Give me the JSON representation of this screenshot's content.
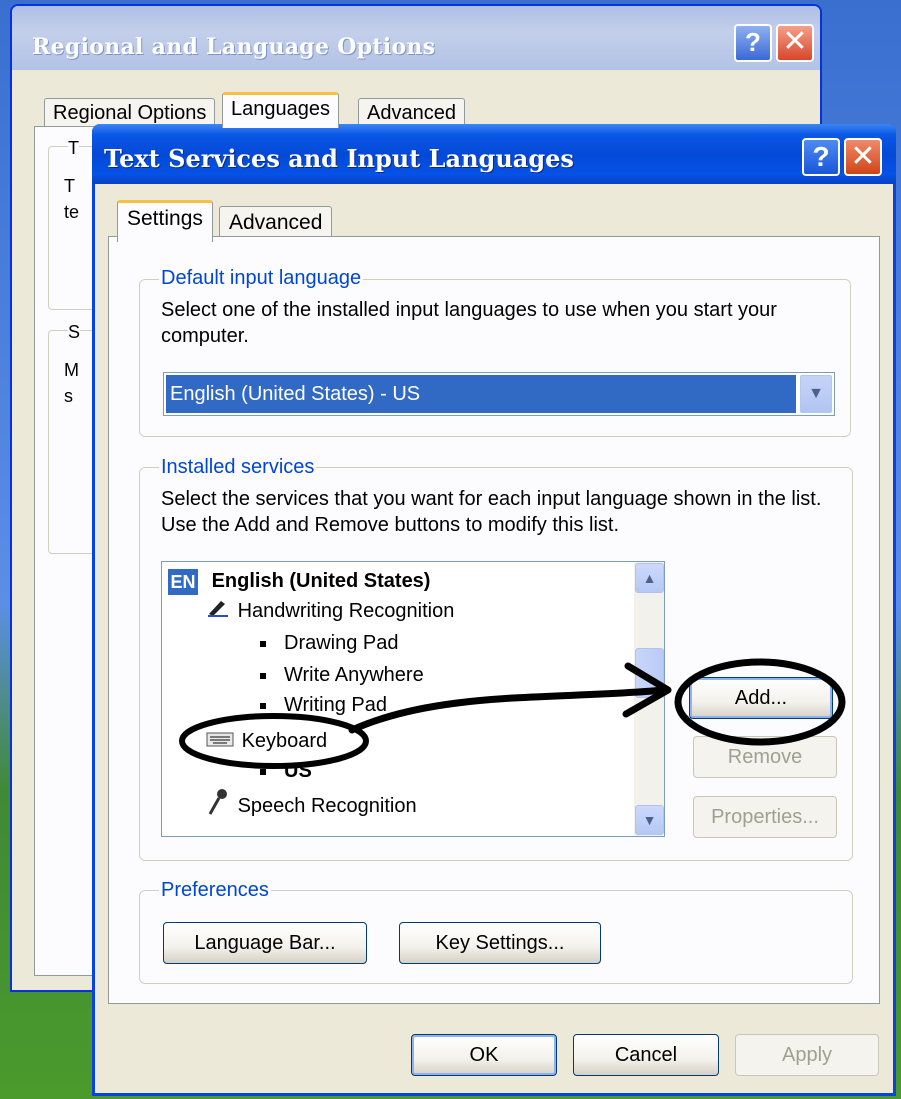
{
  "back_window": {
    "title": "Regional and Language Options",
    "tabs": [
      "Regional Options",
      "Languages",
      "Advanced"
    ],
    "fragments": [
      "T",
      "T",
      "te",
      "S",
      "M",
      "s"
    ]
  },
  "dialog": {
    "title": "Text Services and Input Languages",
    "tabs": [
      {
        "label": "Settings",
        "active": true
      },
      {
        "label": "Advanced",
        "active": false
      }
    ],
    "default_input": {
      "group_label": "Default input language",
      "description": "Select one of the installed input languages to use when you start your computer.",
      "combo_value": "English (United States) - US"
    },
    "installed_services": {
      "group_label": "Installed services",
      "description": "Select the services that you want for each input language shown in the list. Use the Add and Remove buttons to modify this list.",
      "language_badge": "EN",
      "language": "English (United States)",
      "handwriting": "Handwriting Recognition",
      "handwriting_items": [
        "Drawing Pad",
        "Write Anywhere",
        "Writing Pad"
      ],
      "keyboard": "Keyboard",
      "keyboard_layout": "US",
      "speech": "Speech Recognition",
      "add_label": "Add...",
      "remove_label": "Remove",
      "properties_label": "Properties..."
    },
    "preferences": {
      "group_label": "Preferences",
      "language_bar_label": "Language Bar...",
      "key_settings_label": "Key Settings..."
    },
    "footer": {
      "ok_label": "OK",
      "cancel_label": "Cancel",
      "apply_label": "Apply"
    }
  },
  "colors": {
    "title_bar": "#0449d8",
    "selection": "#316ac5",
    "group_label": "#0046d5",
    "dialog_face": "#ece9d8",
    "active_tab_accent": "#f6c042"
  },
  "icons": {
    "help": "help-icon",
    "close": "close-icon",
    "combo_arrow": "chevron-down-icon",
    "handwriting": "pen-icon",
    "keyboard": "keyboard-icon",
    "speech": "microphone-icon"
  }
}
